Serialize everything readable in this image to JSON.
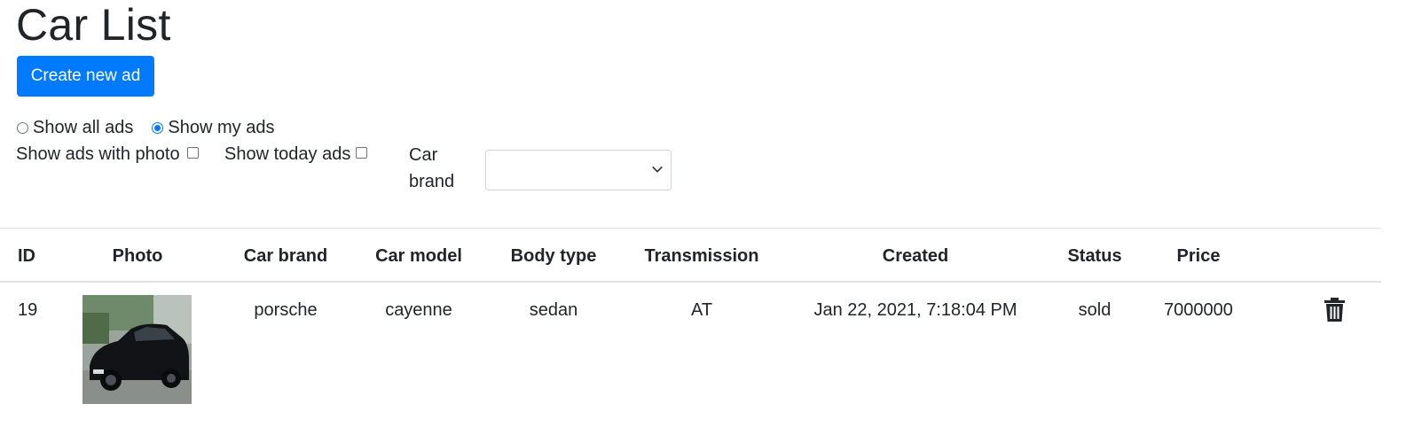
{
  "page": {
    "title": "Car List"
  },
  "actions": {
    "create_label": "Create new ad"
  },
  "filters": {
    "show_all_label": "Show all ads",
    "show_mine_label": "Show my ads",
    "selected": "Show my ads",
    "with_photo_label": "Show ads with photo",
    "with_photo_checked": false,
    "today_label": "Show today ads",
    "today_checked": false,
    "brand_label_line1": "Car",
    "brand_label_line2": "brand",
    "brand_selected": ""
  },
  "table": {
    "headers": [
      "ID",
      "Photo",
      "Car brand",
      "Car model",
      "Body type",
      "Transmission",
      "Created",
      "Status",
      "Price"
    ],
    "rows": [
      {
        "id": "19",
        "photo": "car-photo",
        "brand": "porsche",
        "model": "cayenne",
        "body": "sedan",
        "transmission": "AT",
        "created": "Jan 22, 2021, 7:18:04 PM",
        "status": "sold",
        "price": "7000000",
        "action_icon": "trash-icon"
      }
    ]
  },
  "colors": {
    "primary": "#007bff",
    "text": "#212529",
    "border": "#dee2e6"
  }
}
